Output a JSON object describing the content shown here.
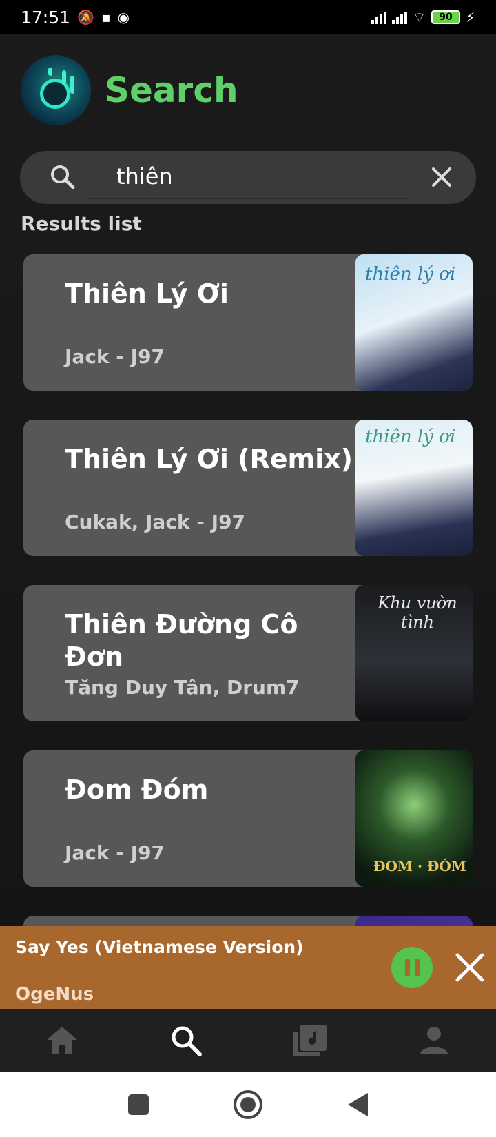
{
  "status_bar": {
    "time": "17:51",
    "battery": "90"
  },
  "header": {
    "title": "Search"
  },
  "search": {
    "value": "thiên"
  },
  "results_label": "Results list",
  "results": [
    {
      "title": "Thiên Lý Ơi",
      "artist": "Jack - J97"
    },
    {
      "title": "Thiên Lý Ơi (Remix)",
      "artist": "Cukak, Jack - J97"
    },
    {
      "title": "Thiên Đường Cô Đơn",
      "artist": "Tăng Duy Tân, Drum7"
    },
    {
      "title": "Đom Đóm",
      "artist": "Jack - J97"
    }
  ],
  "art_text": {
    "art1": "thiên lý ơi",
    "art2": "thiên lý ơi",
    "art3": "Khu vườn tình",
    "art4": "ĐOM · ĐÓM"
  },
  "mini_player": {
    "title": "Say Yes (Vietnamese Version)",
    "artist": "OgeNus"
  },
  "colors": {
    "accent": "#5fd068",
    "player_bg": "#a8682d",
    "card_bg": "#575757"
  },
  "bottom_nav": [
    "home-icon",
    "search-icon",
    "library-icon",
    "profile-icon"
  ]
}
